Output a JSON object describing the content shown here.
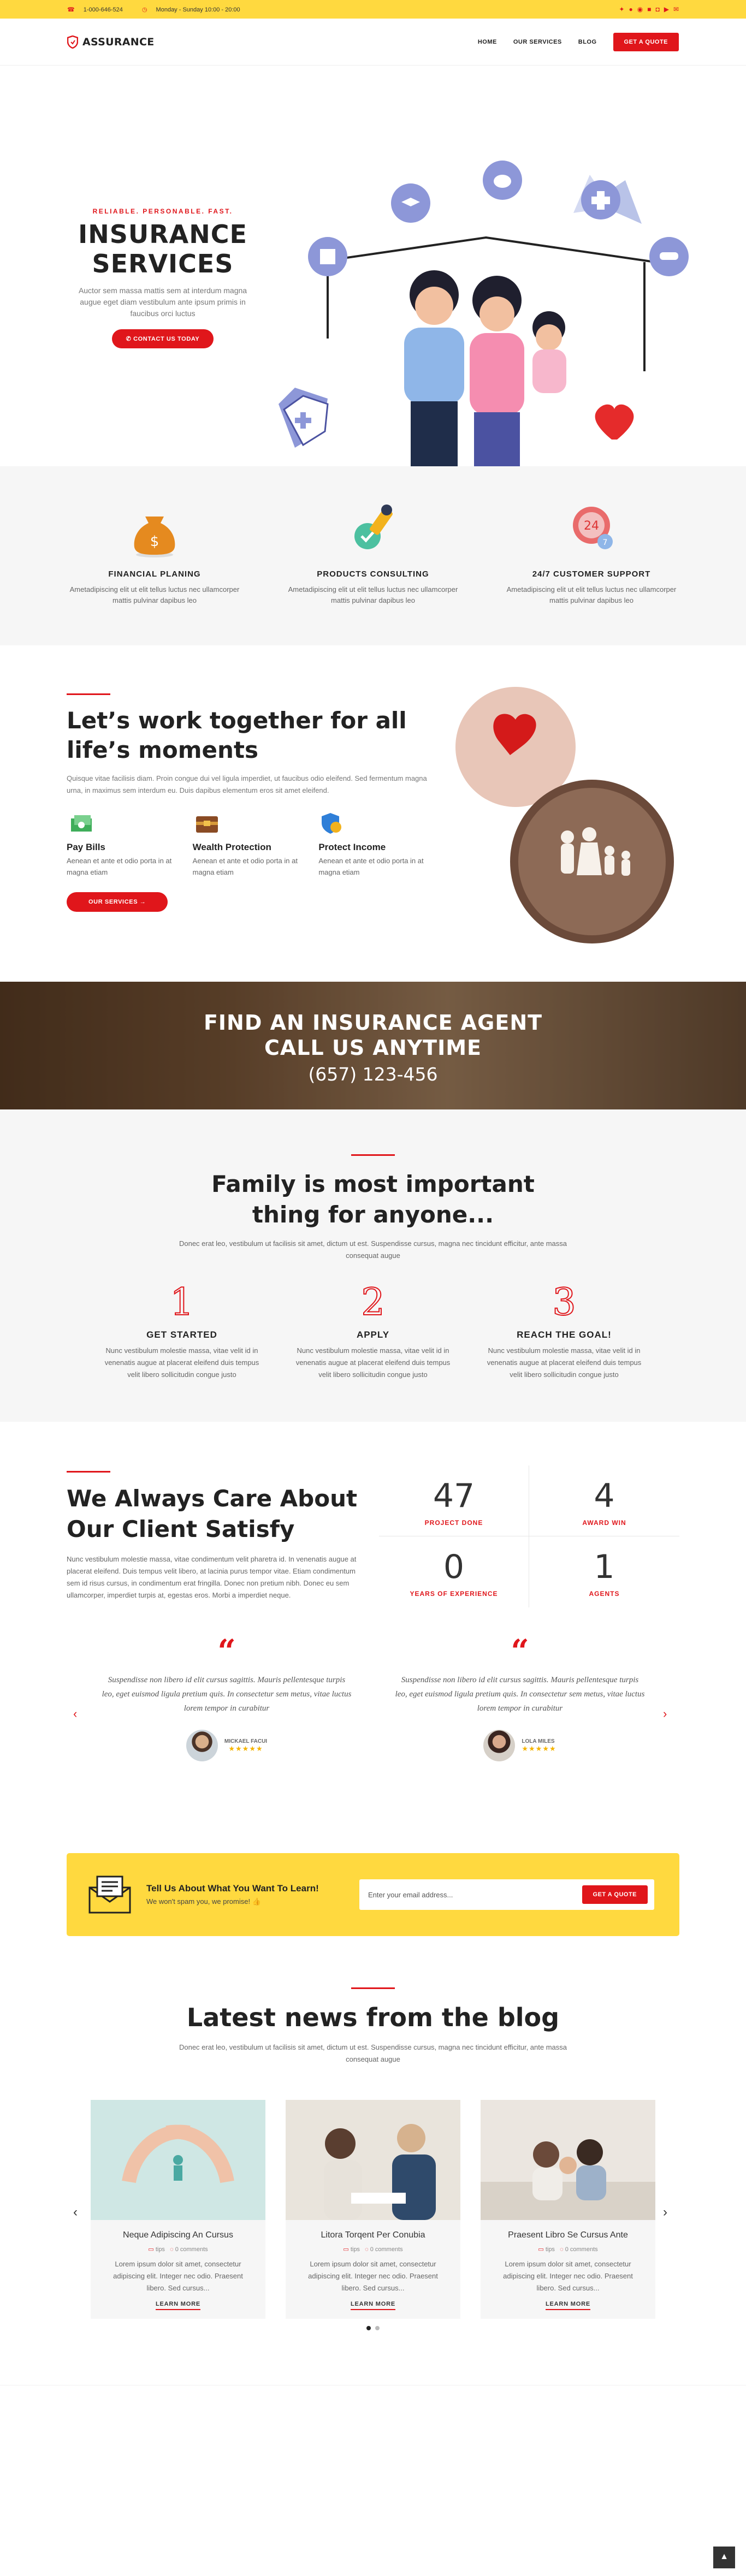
{
  "topbar": {
    "phone": "1-000-646-524",
    "hours": "Monday - Sunday 10:00 - 20:00",
    "social": [
      "twitter-icon",
      "facebook-icon",
      "pinterest-icon",
      "linkedin-icon",
      "instagram-icon",
      "youtube-icon",
      "email-icon"
    ]
  },
  "header": {
    "logo": "ASSURANCE",
    "nav": [
      "HOME",
      "OUR SERVICES",
      "BLOG"
    ],
    "cta": "GET A QUOTE"
  },
  "hero": {
    "kicker": "RELIABLE. PERSONABLE. FAST.",
    "title_line1": "INSURANCE",
    "title_line2": "SERVICES",
    "text": "Auctor sem massa mattis sem at interdum magna augue eget diam vestibulum ante ipsum primis in faucibus orci luctus",
    "button": "CONTACT US TODAY"
  },
  "features": [
    {
      "icon": "money-bag-icon",
      "title": "FINANCIAL PLANING",
      "text": "Ametadipiscing elit ut elit tellus luctus nec ullamcorper mattis pulvinar dapibus leo"
    },
    {
      "icon": "consulting-icon",
      "title": "PRODUCTS CONSULTING",
      "text": "Ametadipiscing elit ut elit tellus luctus nec ullamcorper mattis pulvinar dapibus leo"
    },
    {
      "icon": "support-24-7-icon",
      "title": "24/7 CUSTOMER SUPPORT",
      "text": "Ametadipiscing elit ut elit tellus luctus nec ullamcorper mattis pulvinar dapibus leo"
    }
  ],
  "work": {
    "title": "Let’s work together for all life’s moments",
    "text": "Quisque vitae facilisis diam. Proin congue dui vel ligula imperdiet, ut faucibus odio eleifend. Sed fermentum magna urna, in maximus sem interdum eu. Duis dapibus elementum eros sit amet eleifend.",
    "items": [
      {
        "icon": "pay-bills-icon",
        "title": "Pay Bills",
        "text": "Aenean et ante et odio porta in at magna etiam"
      },
      {
        "icon": "wealth-icon",
        "title": "Wealth Protection",
        "text": "Aenean et ante et odio porta in at magna etiam"
      },
      {
        "icon": "protect-income-icon",
        "title": "Protect Income",
        "text": "Aenean et ante et odio porta in at magna etiam"
      }
    ],
    "button": "OUR SERVICES"
  },
  "agent": {
    "line1": "FIND AN INSURANCE AGENT",
    "line2": "CALL US ANYTIME",
    "phone": "(657) 123-456"
  },
  "family": {
    "title_line1": "Family is most important",
    "title_line2": "thing for anyone...",
    "text": "Donec erat leo, vestibulum ut facilisis sit amet, dictum ut est. Suspendisse cursus, magna nec tincidunt efficitur, ante massa consequat augue",
    "steps": [
      {
        "num": "1",
        "title": "GET STARTED",
        "text": "Nunc vestibulum molestie massa, vitae velit id in venenatis augue at placerat eleifend duis tempus velit libero sollicitudin congue justo"
      },
      {
        "num": "2",
        "title": "APPLY",
        "text": "Nunc vestibulum molestie massa, vitae velit id in venenatis augue at placerat eleifend duis tempus velit libero sollicitudin congue justo"
      },
      {
        "num": "3",
        "title": "REACH THE GOAL!",
        "text": "Nunc vestibulum molestie massa, vitae velit id in venenatis augue at placerat eleifend duis tempus velit libero sollicitudin congue justo"
      }
    ]
  },
  "care": {
    "title": "We Always Care About Our Client Satisfy",
    "text": "Nunc vestibulum molestie massa, vitae condimentum velit pharetra id. In venenatis augue at placerat eleifend. Duis tempus velit libero, at lacinia purus tempor vitae. Etiam condimentum sem id risus cursus, in condimentum erat fringilla. Donec non pretium nibh. Donec eu sem ullamcorper, imperdiet turpis at, egestas eros. Morbi a imperdiet neque.",
    "stats": [
      {
        "value": "47",
        "label": "PROJECT DONE"
      },
      {
        "value": "4",
        "label": "AWARD WIN"
      },
      {
        "value": "0",
        "label": "YEARS OF EXPERIENCE"
      },
      {
        "value": "1",
        "label": "AGENTS"
      }
    ]
  },
  "testimonials": [
    {
      "quote": "Suspendisse non libero id elit cursus sagittis. Mauris pellentesque turpis leo, eget euismod ligula pretium quis. In consectetur sem metus, vitae luctus lorem tempor in curabitur",
      "name": "MICKAEL FACUI",
      "stars": "★★★★★"
    },
    {
      "quote": "Suspendisse non libero id elit cursus sagittis. Mauris pellentesque turpis leo, eget euismod ligula pretium quis. In consectetur sem metus, vitae luctus lorem tempor in curabitur",
      "name": "LOLA MILES",
      "stars": "★★★★★"
    }
  ],
  "newsletter": {
    "title": "Tell Us About What You Want To Learn!",
    "subtitle": "We won't spam you, we promise! 👍",
    "placeholder": "Enter your email address...",
    "button": "GET A QUOTE"
  },
  "blog": {
    "title": "Latest news from the blog",
    "text": "Donec erat leo, vestibulum ut facilisis sit amet, dictum ut est. Suspendisse cursus, magna nec tincidunt efficitur, ante massa consequat augue",
    "posts": [
      {
        "title": "Neque Adipiscing An Cursus",
        "category": "tips",
        "comments": "0 comments",
        "text": "Lorem ipsum dolor sit amet, consectetur adipiscing elit. Integer nec odio. Praesent libero. Sed cursus...",
        "more": "LEARN MORE"
      },
      {
        "title": "Litora Torqent Per Conubia",
        "category": "tips",
        "comments": "0 comments",
        "text": "Lorem ipsum dolor sit amet, consectetur adipiscing elit. Integer nec odio. Praesent libero. Sed cursus...",
        "more": "LEARN MORE"
      },
      {
        "title": "Praesent Libro Se Cursus Ante",
        "category": "tips",
        "comments": "0 comments",
        "text": "Lorem ipsum dolor sit amet, consectetur adipiscing elit. Integer nec odio. Praesent libero. Sed cursus...",
        "more": "LEARN MORE"
      }
    ]
  },
  "colors": {
    "accent": "#e0161b",
    "yellow": "#ffd93f",
    "light_bg": "#f6f6f6"
  }
}
